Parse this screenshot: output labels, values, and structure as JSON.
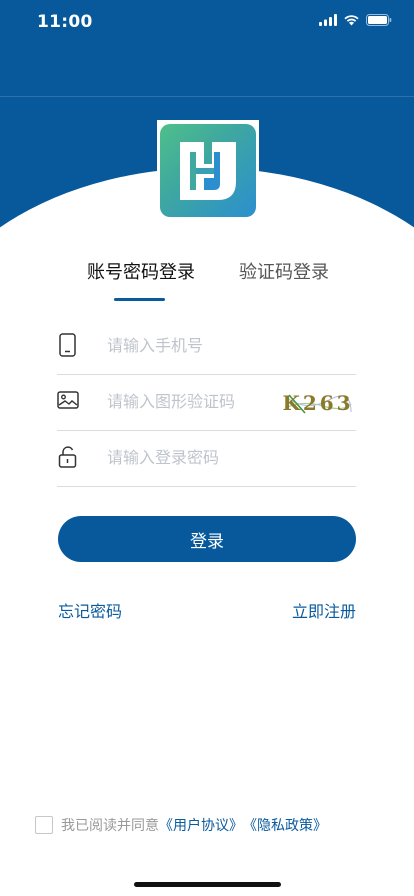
{
  "status_bar": {
    "time": "11:00"
  },
  "tabs": [
    {
      "label": "账号密码登录",
      "active": true
    },
    {
      "label": "验证码登录",
      "active": false
    }
  ],
  "form": {
    "phone_placeholder": "请输入手机号",
    "captcha_placeholder": "请输入图形验证码",
    "password_placeholder": "请输入登录密码",
    "captcha_text": "K263"
  },
  "login_label": "登录",
  "links": {
    "forgot": "忘记密码",
    "register": "立即注册"
  },
  "agreement": {
    "prefix": "我已阅读并同意",
    "user_agreement": "《用户协议》",
    "privacy_policy": "《隐私政策》"
  },
  "colors": {
    "primary": "#07599c",
    "placeholder": "#bfc4cc",
    "divider": "#dcdcdc"
  }
}
